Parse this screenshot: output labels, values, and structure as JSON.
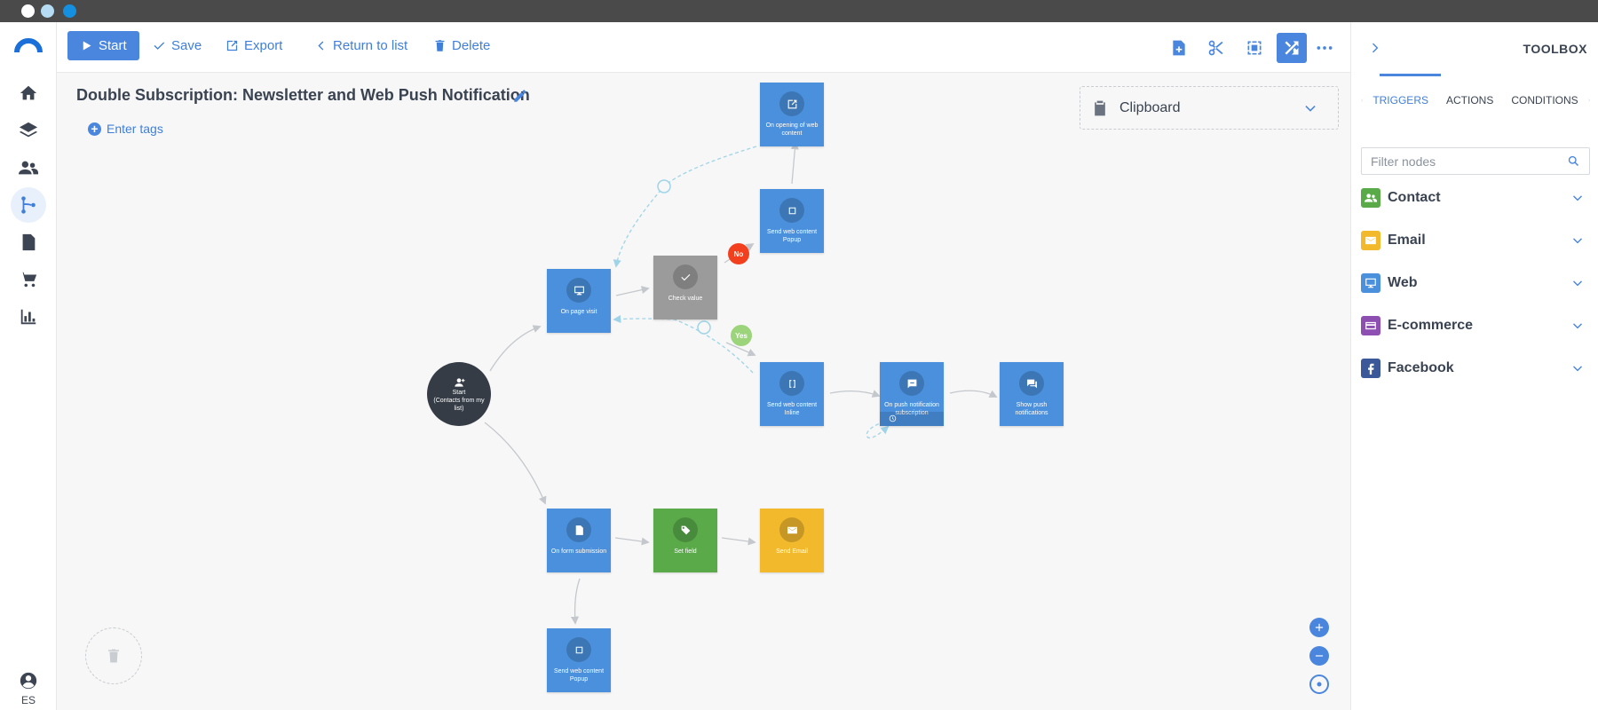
{
  "toolbar": {
    "start_label": "Start",
    "save_label": "Save",
    "export_label": "Export",
    "return_label": "Return to list",
    "delete_label": "Delete"
  },
  "workflow": {
    "title": "Double Subscription: Newsletter and Web Push Notification",
    "tags_label": "Enter tags"
  },
  "clipboard": {
    "label": "Clipboard"
  },
  "nodes": {
    "start_line1": "Start",
    "start_line2": "(Contacts from my list)",
    "on_page_visit": "On page visit",
    "check_value": "Check value",
    "opening_web_content": "On opening of web content",
    "send_popup_top": "Send web content Popup",
    "send_inline": "Send web content Inline",
    "push_subscription": "On push notification subscription",
    "show_push": "Show push notifications",
    "on_form_submission": "On form submission",
    "set_field": "Set field",
    "send_email": "Send Email",
    "send_popup_bottom": "Send web content Popup"
  },
  "badges": {
    "no": "No",
    "yes": "Yes"
  },
  "nav": {
    "language": "ES"
  },
  "toolbox": {
    "title": "TOOLBOX",
    "tabs": [
      "TRIGGERS",
      "ACTIONS",
      "CONDITIONS"
    ],
    "active_tab": "TRIGGERS",
    "filter_placeholder": "Filter nodes",
    "categories": [
      {
        "label": "Contact",
        "color": "#5aaa4a"
      },
      {
        "label": "Email",
        "color": "#f2b92c"
      },
      {
        "label": "Web",
        "color": "#4a90dc"
      },
      {
        "label": "E-commerce",
        "color": "#8e4fb3"
      },
      {
        "label": "Facebook",
        "color": "#3b5998"
      }
    ]
  },
  "colors": {
    "accent": "#4a86de",
    "node_blue": "#4a90dc",
    "node_gray": "#9b9b9b",
    "node_green": "#5aaa4a",
    "node_yellow": "#f2b92c",
    "badge_no": "#f2401f",
    "badge_yes": "#9bd47a",
    "start_node": "#353c46"
  }
}
